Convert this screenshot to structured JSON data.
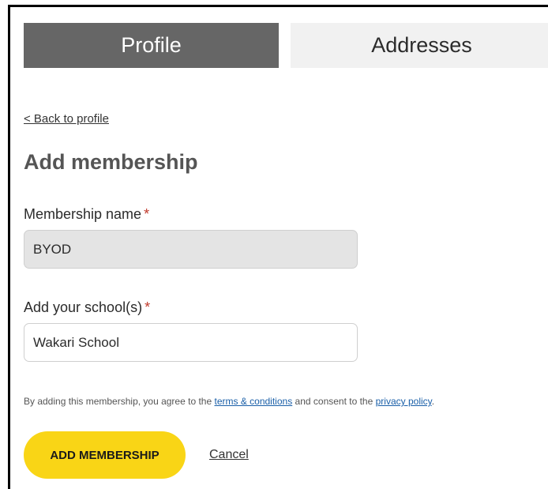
{
  "tabs": {
    "profile": "Profile",
    "addresses": "Addresses"
  },
  "back_link": "< Back to profile",
  "page_title": "Add membership",
  "form": {
    "membership_name": {
      "label": "Membership name",
      "required_mark": "*",
      "value": "BYOD"
    },
    "school": {
      "label": "Add your school(s)",
      "required_mark": "*",
      "value": "Wakari School"
    }
  },
  "consent": {
    "prefix": "By adding this membership, you agree to the ",
    "terms_link": "terms & conditions",
    "middle": " and consent to the ",
    "privacy_link": "privacy policy",
    "suffix": "."
  },
  "actions": {
    "add_label": "ADD MEMBERSHIP",
    "cancel_label": "Cancel"
  },
  "colors": {
    "active_tab": "#666666",
    "inactive_tab": "#f1f1f1",
    "primary_button": "#f9d516",
    "required": "#c0392b",
    "link": "#1a5fa8"
  }
}
